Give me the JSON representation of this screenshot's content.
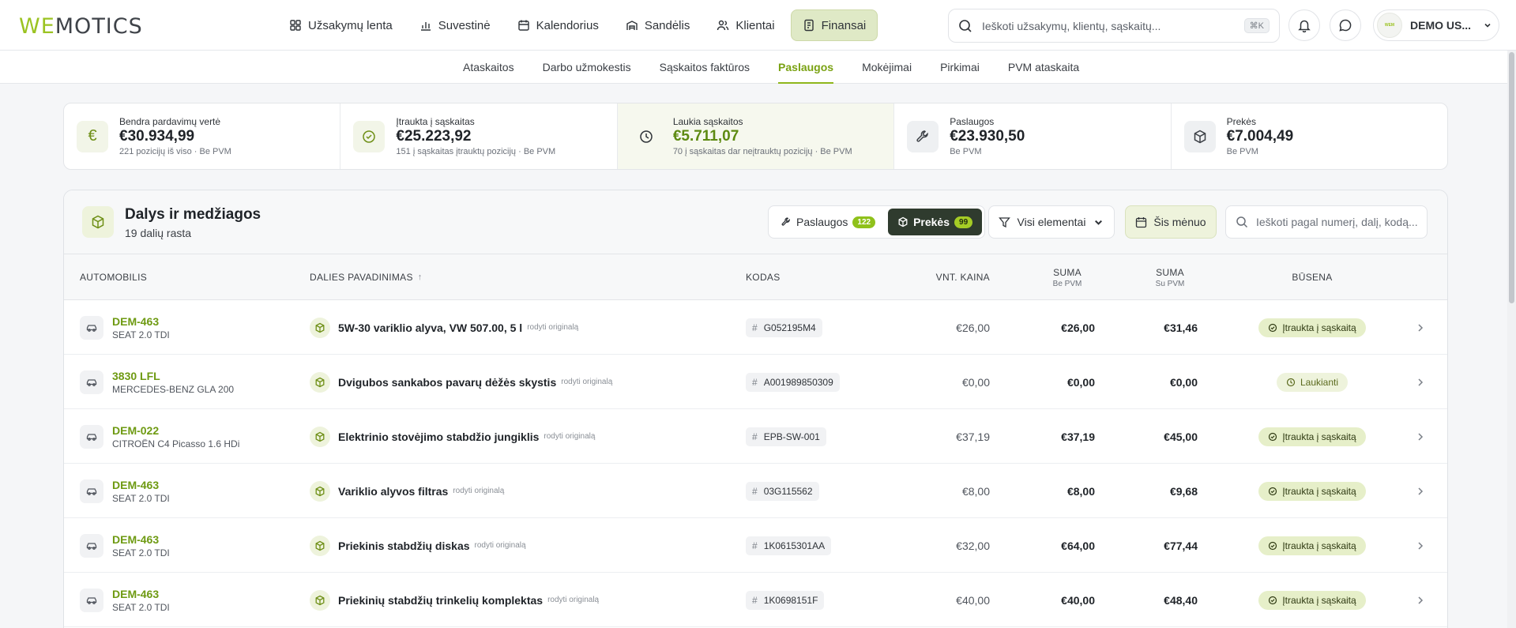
{
  "brand": {
    "logo_a": "WE",
    "logo_b": "MOTICS",
    "accent": "#9bc322"
  },
  "nav": {
    "items": [
      {
        "label": "Užsakymų lenta",
        "icon": "grid-icon"
      },
      {
        "label": "Suvestinė",
        "icon": "bar-chart-icon"
      },
      {
        "label": "Kalendorius",
        "icon": "calendar-icon"
      },
      {
        "label": "Sandėlis",
        "icon": "warehouse-icon"
      },
      {
        "label": "Klientai",
        "icon": "users-icon"
      },
      {
        "label": "Finansai",
        "icon": "receipt-icon",
        "active": true
      }
    ]
  },
  "search": {
    "placeholder": "Ieškoti užsakymų, klientų, sąskaitų...",
    "shortcut": "⌘K"
  },
  "user": {
    "name": "DEMO US..."
  },
  "subnav": {
    "items": [
      "Ataskaitos",
      "Darbo užmokestis",
      "Sąskaitos faktūros",
      "Paslaugos",
      "Mokėjimai",
      "Pirkimai",
      "PVM ataskaita"
    ],
    "active": "Paslaugos"
  },
  "stats": [
    {
      "label": "Bendra pardavimų vertė",
      "value": "€30.934,99",
      "sub": "221 pozicijų iš viso · Be PVM",
      "icon": "euro-icon"
    },
    {
      "label": "Įtraukta į sąskaitas",
      "value": "€25.223,92",
      "sub": "151 į sąskaitas įtrauktų pozicijų · Be PVM",
      "icon": "check-circle-icon"
    },
    {
      "label": "Laukia sąskaitos",
      "value": "€5.711,07",
      "sub": "70 į sąskaitas dar neįtrauktų pozicijų · Be PVM",
      "icon": "clock-icon"
    },
    {
      "label": "Paslaugos",
      "value": "€23.930,50",
      "sub": "Be PVM",
      "icon": "wrench-icon"
    },
    {
      "label": "Prekės",
      "value": "€7.004,49",
      "sub": "Be PVM",
      "icon": "box-icon"
    }
  ],
  "panel": {
    "title": "Dalys ir medžiagos",
    "subtitle": "19 dalių rasta",
    "toggle": [
      {
        "label": "Paslaugos",
        "count": "122"
      },
      {
        "label": "Prekės",
        "count": "99",
        "active": true
      }
    ],
    "filter_label": "Visi elementai",
    "period_label": "Šis mėnuo",
    "search_placeholder": "Ieškoti pagal numerį, dalį, kodą..."
  },
  "table": {
    "headers": {
      "car": "Automobilis",
      "part": "Dalies pavadinimas",
      "code": "Kodas",
      "unit_price": "Vnt. kaina",
      "sum_net": "Suma",
      "sum_net_sub": "Be PVM",
      "sum_gross": "Suma",
      "sum_gross_sub": "Su PVM",
      "status": "Būsena"
    },
    "original_link": "rodyti originalą",
    "rows": [
      {
        "plate": "DEM-463",
        "model": "SEAT 2.0 TDI",
        "part": "5W-30 variklio alyva, VW 507.00, 5 l",
        "code": "G052195M4",
        "unit": "€26,00",
        "net": "€26,00",
        "gross": "€31,46",
        "status": "Įtraukta į sąskaitą",
        "waiting": false
      },
      {
        "plate": "3830 LFL",
        "model": "MERCEDES-BENZ GLA 200",
        "part": "Dvigubos sankabos pavarų dėžės skystis",
        "code": "A001989850309",
        "unit": "€0,00",
        "net": "€0,00",
        "gross": "€0,00",
        "status": "Laukianti",
        "waiting": true
      },
      {
        "plate": "DEM-022",
        "model": "CITROËN C4 Picasso 1.6 HDi",
        "part": "Elektrinio stovėjimo stabdžio jungiklis",
        "code": "EPB-SW-001",
        "unit": "€37,19",
        "net": "€37,19",
        "gross": "€45,00",
        "status": "Įtraukta į sąskaitą",
        "waiting": false
      },
      {
        "plate": "DEM-463",
        "model": "SEAT 2.0 TDI",
        "part": "Variklio alyvos filtras",
        "code": "03G115562",
        "unit": "€8,00",
        "net": "€8,00",
        "gross": "€9,68",
        "status": "Įtraukta į sąskaitą",
        "waiting": false
      },
      {
        "plate": "DEM-463",
        "model": "SEAT 2.0 TDI",
        "part": "Priekinis stabdžių diskas",
        "code": "1K0615301AA",
        "unit": "€32,00",
        "net": "€64,00",
        "gross": "€77,44",
        "status": "Įtraukta į sąskaitą",
        "waiting": false
      },
      {
        "plate": "DEM-463",
        "model": "SEAT 2.0 TDI",
        "part": "Priekinių stabdžių trinkelių komplektas",
        "code": "1K0698151F",
        "unit": "€40,00",
        "net": "€40,00",
        "gross": "€48,40",
        "status": "Įtraukta į sąskaitą",
        "waiting": false
      }
    ]
  }
}
